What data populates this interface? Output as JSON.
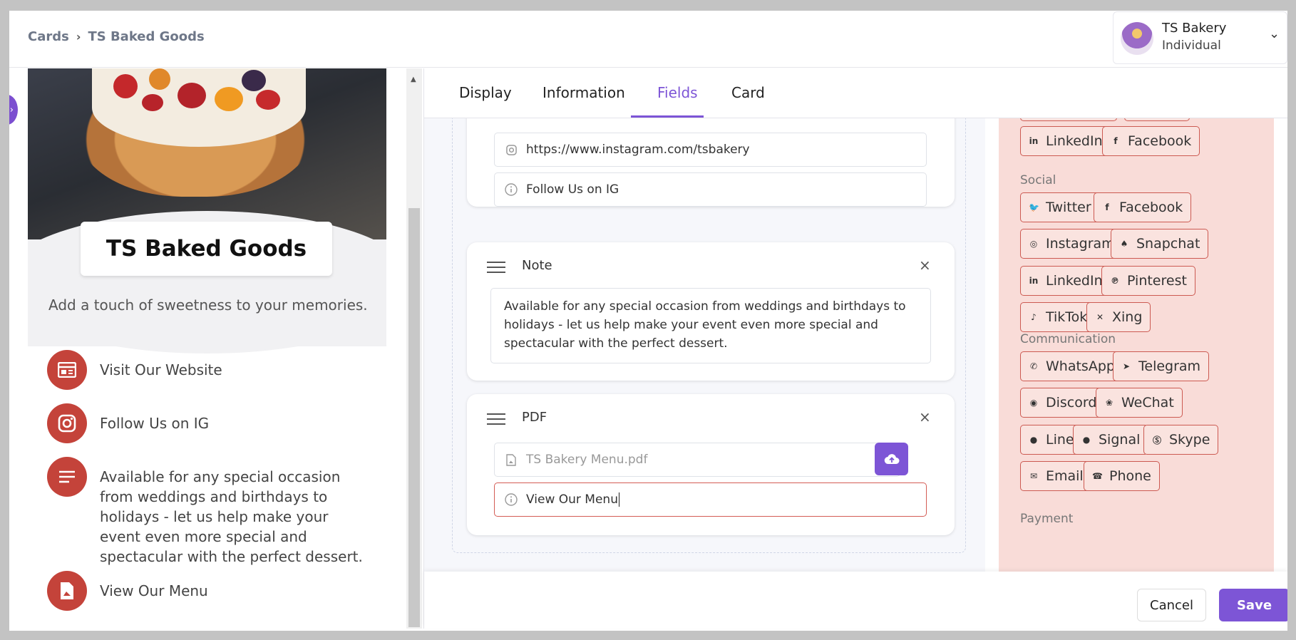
{
  "header": {
    "breadcrumb": [
      "Cards",
      "TS Baked Goods"
    ],
    "account": {
      "name": "TS Bakery",
      "type": "Individual"
    }
  },
  "preview": {
    "title": "TS Baked Goods",
    "tagline": "Add a touch of sweetness to your memories.",
    "links": [
      {
        "icon": "website-icon",
        "label": "Visit Our Website"
      },
      {
        "icon": "instagram-icon",
        "label": "Follow Us on IG"
      },
      {
        "icon": "note-icon",
        "label": "Available for any special occasion from weddings and birthdays to holidays - let us help make your event even more special and spectacular with the perfect dessert."
      },
      {
        "icon": "pdf-icon",
        "label": "View Our Menu"
      }
    ]
  },
  "tabs": [
    "Display",
    "Information",
    "Fields",
    "Card"
  ],
  "active_tab": "Fields",
  "fields": {
    "instagram": {
      "url": "https://www.instagram.com/tsbakery",
      "label": "Follow Us on IG"
    },
    "note": {
      "title": "Note",
      "text": "Available for any special occasion from weddings and birthdays to holidays - let us help make your event even more special and spectacular with the perfect dessert."
    },
    "pdf": {
      "title": "PDF",
      "file": "TS Bakery Menu.pdf",
      "label": "View Our Menu"
    }
  },
  "field_palette": {
    "top_chips": [
      "LinkedIn",
      "Facebook"
    ],
    "sections": [
      {
        "title": "Social",
        "chips": [
          "Twitter",
          "Facebook",
          "Instagram",
          "Snapchat",
          "LinkedIn",
          "Pinterest",
          "TikTok",
          "Xing"
        ]
      },
      {
        "title": "Communication",
        "chips": [
          "WhatsApp",
          "Telegram",
          "Discord",
          "WeChat",
          "Line",
          "Signal",
          "Skype",
          "Email",
          "Phone"
        ]
      },
      {
        "title": "Payment",
        "chips": []
      }
    ]
  },
  "footer": {
    "cancel": "Cancel",
    "save": "Save"
  },
  "colors": {
    "accent": "#7d55d6",
    "brand_red": "#c4433a",
    "palette_bg": "#f9dcd8"
  }
}
